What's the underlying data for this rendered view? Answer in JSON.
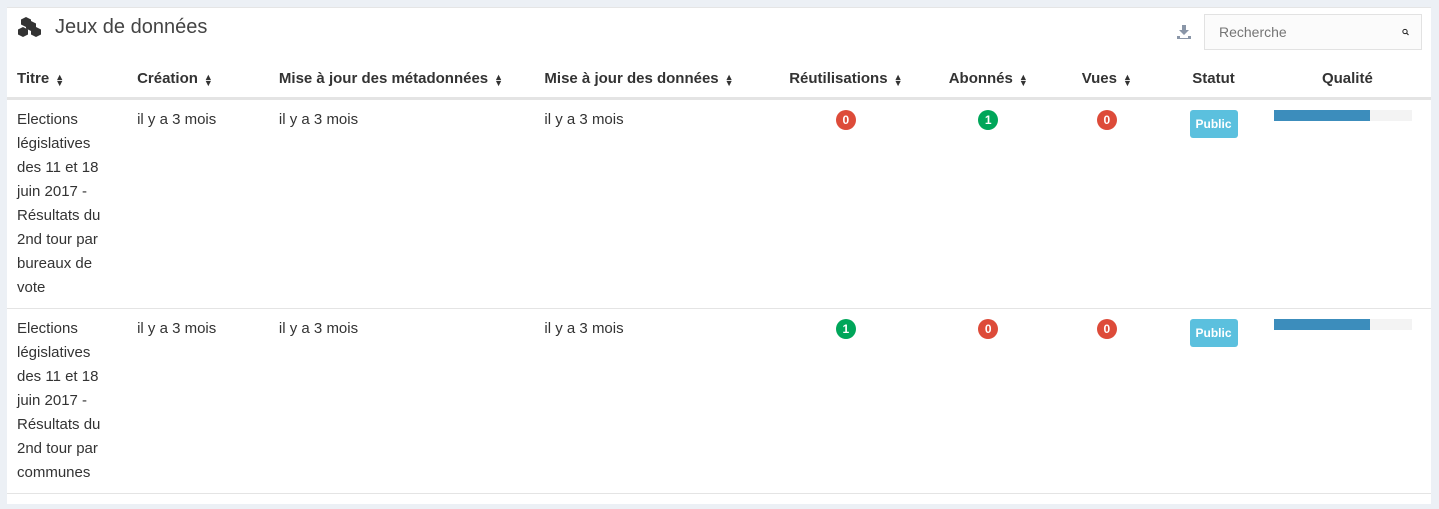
{
  "header": {
    "title": "Jeux de données",
    "icon": "cubes-icon",
    "search_placeholder": "Recherche"
  },
  "colors": {
    "zero": "#dd4b39",
    "nonzero": "#00a65a",
    "public": "#5bc0de",
    "quality": "#3c8dbc"
  },
  "columns": [
    "Titre",
    "Création",
    "Mise à jour des métadonnées",
    "Mise à jour des données",
    "Réutilisations",
    "Abonnés",
    "Vues",
    "Statut",
    "Qualité"
  ],
  "rows": [
    {
      "title": "Elections législatives des 11 et 18 juin 2017 - Résultats du 2nd tour par bureaux de vote",
      "created": "il y a 3 mois",
      "meta_updated": "il y a 3 mois",
      "data_updated": "il y a 3 mois",
      "reuses": "0",
      "followers": "1",
      "views": "0",
      "status": "Public",
      "quality": 0.7
    },
    {
      "title": "Elections législatives des 11 et 18 juin 2017 - Résultats du 2nd tour par communes",
      "created": "il y a 3 mois",
      "meta_updated": "il y a 3 mois",
      "data_updated": "il y a 3 mois",
      "reuses": "1",
      "followers": "0",
      "views": "0",
      "status": "Public",
      "quality": 0.7
    }
  ]
}
